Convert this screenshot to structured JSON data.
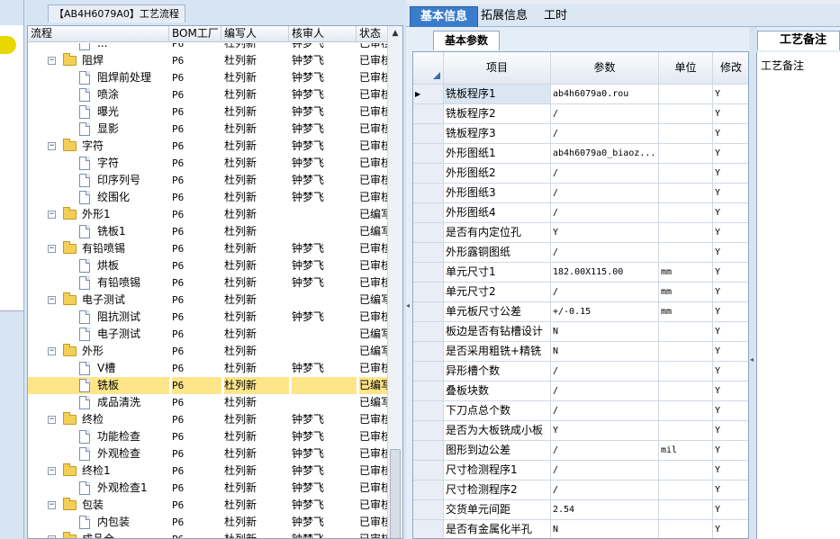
{
  "tree": {
    "title": "【AB4H6079A0】工艺流程",
    "columns": [
      "流程",
      "BOM工厂",
      "编写人",
      "核审人",
      "状态"
    ],
    "rows": [
      {
        "name": "...",
        "level": 2,
        "kind": "doc",
        "bom": "P6",
        "writer": "杜列新",
        "reviewer": "钟梦飞",
        "status": "已审核"
      },
      {
        "name": "阻焊",
        "level": 1,
        "kind": "folder",
        "bom": "P6",
        "writer": "杜列新",
        "reviewer": "钟梦飞",
        "status": "已审核"
      },
      {
        "name": "阻焊前处理",
        "level": 2,
        "kind": "doc",
        "bom": "P6",
        "writer": "杜列新",
        "reviewer": "钟梦飞",
        "status": "已审核"
      },
      {
        "name": "喷涂",
        "level": 2,
        "kind": "doc",
        "bom": "P6",
        "writer": "杜列新",
        "reviewer": "钟梦飞",
        "status": "已审核"
      },
      {
        "name": "曝光",
        "level": 2,
        "kind": "doc",
        "bom": "P6",
        "writer": "杜列新",
        "reviewer": "钟梦飞",
        "status": "已审核"
      },
      {
        "name": "显影",
        "level": 2,
        "kind": "doc",
        "bom": "P6",
        "writer": "杜列新",
        "reviewer": "钟梦飞",
        "status": "已审核"
      },
      {
        "name": "字符",
        "level": 1,
        "kind": "folder",
        "bom": "P6",
        "writer": "杜列新",
        "reviewer": "钟梦飞",
        "status": "已审核"
      },
      {
        "name": "字符",
        "level": 2,
        "kind": "doc",
        "bom": "P6",
        "writer": "杜列新",
        "reviewer": "钟梦飞",
        "status": "已审核"
      },
      {
        "name": "印序列号",
        "level": 2,
        "kind": "doc",
        "bom": "P6",
        "writer": "杜列新",
        "reviewer": "钟梦飞",
        "status": "已审核"
      },
      {
        "name": "绞围化",
        "level": 2,
        "kind": "doc",
        "bom": "P6",
        "writer": "杜列新",
        "reviewer": "钟梦飞",
        "status": "已审核"
      },
      {
        "name": "外形1",
        "level": 1,
        "kind": "folder",
        "bom": "P6",
        "writer": "杜列新",
        "reviewer": "",
        "status": "已编写"
      },
      {
        "name": "铣板1",
        "level": 2,
        "kind": "doc",
        "bom": "P6",
        "writer": "杜列新",
        "reviewer": "",
        "status": "已编写"
      },
      {
        "name": "有铅喷锡",
        "level": 1,
        "kind": "folder",
        "bom": "P6",
        "writer": "杜列新",
        "reviewer": "钟梦飞",
        "status": "已审核"
      },
      {
        "name": "烘板",
        "level": 2,
        "kind": "doc",
        "bom": "P6",
        "writer": "杜列新",
        "reviewer": "钟梦飞",
        "status": "已审核"
      },
      {
        "name": "有铅喷锡",
        "level": 2,
        "kind": "doc",
        "bom": "P6",
        "writer": "杜列新",
        "reviewer": "钟梦飞",
        "status": "已审核"
      },
      {
        "name": "电子测试",
        "level": 1,
        "kind": "folder",
        "bom": "P6",
        "writer": "杜列新",
        "reviewer": "",
        "status": "已编写"
      },
      {
        "name": "阻抗测试",
        "level": 2,
        "kind": "doc",
        "bom": "P6",
        "writer": "杜列新",
        "reviewer": "钟梦飞",
        "status": "已审核"
      },
      {
        "name": "电子测试",
        "level": 2,
        "kind": "doc",
        "bom": "P6",
        "writer": "杜列新",
        "reviewer": "",
        "status": "已编写"
      },
      {
        "name": "外形",
        "level": 1,
        "kind": "folder",
        "bom": "P6",
        "writer": "杜列新",
        "reviewer": "",
        "status": "已编写"
      },
      {
        "name": "V槽",
        "level": 2,
        "kind": "doc",
        "bom": "P6",
        "writer": "杜列新",
        "reviewer": "钟梦飞",
        "status": "已审核"
      },
      {
        "name": "铣板",
        "level": 2,
        "kind": "doc",
        "bom": "P6",
        "writer": "杜列新",
        "reviewer": "",
        "status": "已编写",
        "selected": true
      },
      {
        "name": "成品清洗",
        "level": 2,
        "kind": "doc",
        "bom": "P6",
        "writer": "杜列新",
        "reviewer": "",
        "status": "已编写"
      },
      {
        "name": "终检",
        "level": 1,
        "kind": "folder",
        "bom": "P6",
        "writer": "杜列新",
        "reviewer": "钟梦飞",
        "status": "已审核"
      },
      {
        "name": "功能检查",
        "level": 2,
        "kind": "doc",
        "bom": "P6",
        "writer": "杜列新",
        "reviewer": "钟梦飞",
        "status": "已审核"
      },
      {
        "name": "外观检查",
        "level": 2,
        "kind": "doc",
        "bom": "P6",
        "writer": "杜列新",
        "reviewer": "钟梦飞",
        "status": "已审核"
      },
      {
        "name": "终检1",
        "level": 1,
        "kind": "folder",
        "bom": "P6",
        "writer": "杜列新",
        "reviewer": "钟梦飞",
        "status": "已审核"
      },
      {
        "name": "外观检查1",
        "level": 2,
        "kind": "doc",
        "bom": "P6",
        "writer": "杜列新",
        "reviewer": "钟梦飞",
        "status": "已审核"
      },
      {
        "name": "包装",
        "level": 1,
        "kind": "folder",
        "bom": "P6",
        "writer": "杜列新",
        "reviewer": "钟梦飞",
        "status": "已审核"
      },
      {
        "name": "内包装",
        "level": 2,
        "kind": "doc",
        "bom": "P6",
        "writer": "杜列新",
        "reviewer": "钟梦飞",
        "status": "已审核"
      },
      {
        "name": "成品仓",
        "level": 1,
        "kind": "folder",
        "bom": "P6",
        "writer": "杜列新",
        "reviewer": "钟梦飞",
        "status": "已审核"
      }
    ]
  },
  "tabs": {
    "items": [
      "基本信息",
      "拓展信息",
      "工时"
    ],
    "active": 0
  },
  "params": {
    "subtab": "基本参数",
    "columns": [
      "项目",
      "参数",
      "单位",
      "修改"
    ],
    "rows": [
      {
        "item": "铣板程序1",
        "value": "ab4h6079a0.rou",
        "unit": "",
        "mod": "Y",
        "current": true
      },
      {
        "item": "铣板程序2",
        "value": "/",
        "unit": "",
        "mod": "Y"
      },
      {
        "item": "铣板程序3",
        "value": "/",
        "unit": "",
        "mod": "Y"
      },
      {
        "item": "外形图纸1",
        "value": "ab4h6079a0_biaoz...",
        "unit": "",
        "mod": "Y"
      },
      {
        "item": "外形图纸2",
        "value": "/",
        "unit": "",
        "mod": "Y"
      },
      {
        "item": "外形图纸3",
        "value": "/",
        "unit": "",
        "mod": "Y"
      },
      {
        "item": "外形图纸4",
        "value": "/",
        "unit": "",
        "mod": "Y"
      },
      {
        "item": "是否有内定位孔",
        "value": "Y",
        "unit": "",
        "mod": "Y"
      },
      {
        "item": "外形露铜图纸",
        "value": "/",
        "unit": "",
        "mod": "Y"
      },
      {
        "item": "单元尺寸1",
        "value": "182.00X115.00",
        "unit": "mm",
        "mod": "Y"
      },
      {
        "item": "单元尺寸2",
        "value": "/",
        "unit": "mm",
        "mod": "Y"
      },
      {
        "item": "单元板尺寸公差",
        "value": "+/-0.15",
        "unit": "mm",
        "mod": "Y"
      },
      {
        "item": "板边是否有钻槽设计",
        "value": "N",
        "unit": "",
        "mod": "Y"
      },
      {
        "item": "是否采用粗铣+精铣",
        "value": "N",
        "unit": "",
        "mod": "Y"
      },
      {
        "item": "异形槽个数",
        "value": "/",
        "unit": "",
        "mod": "Y"
      },
      {
        "item": "叠板块数",
        "value": "/",
        "unit": "",
        "mod": "Y"
      },
      {
        "item": "下刀点总个数",
        "value": "/",
        "unit": "",
        "mod": "Y"
      },
      {
        "item": "是否为大板铣成小板",
        "value": "Y",
        "unit": "",
        "mod": "Y"
      },
      {
        "item": "图形到边公差",
        "value": "/",
        "unit": "mil",
        "mod": "Y"
      },
      {
        "item": "尺寸检测程序1",
        "value": "/",
        "unit": "",
        "mod": "Y"
      },
      {
        "item": "尺寸检测程序2",
        "value": "/",
        "unit": "",
        "mod": "Y"
      },
      {
        "item": "交货单元间距",
        "value": "2.54",
        "unit": "",
        "mod": "Y"
      },
      {
        "item": "是否有金属化半孔",
        "value": "N",
        "unit": "",
        "mod": "Y"
      }
    ]
  },
  "notes": {
    "tab": "工艺备注",
    "label": "工艺备注"
  },
  "colors": {
    "accent": "#3a7ccc",
    "selected_row": "#fde58a",
    "panel_bg": "#d7e4f2",
    "folder": "#f4cf58"
  }
}
